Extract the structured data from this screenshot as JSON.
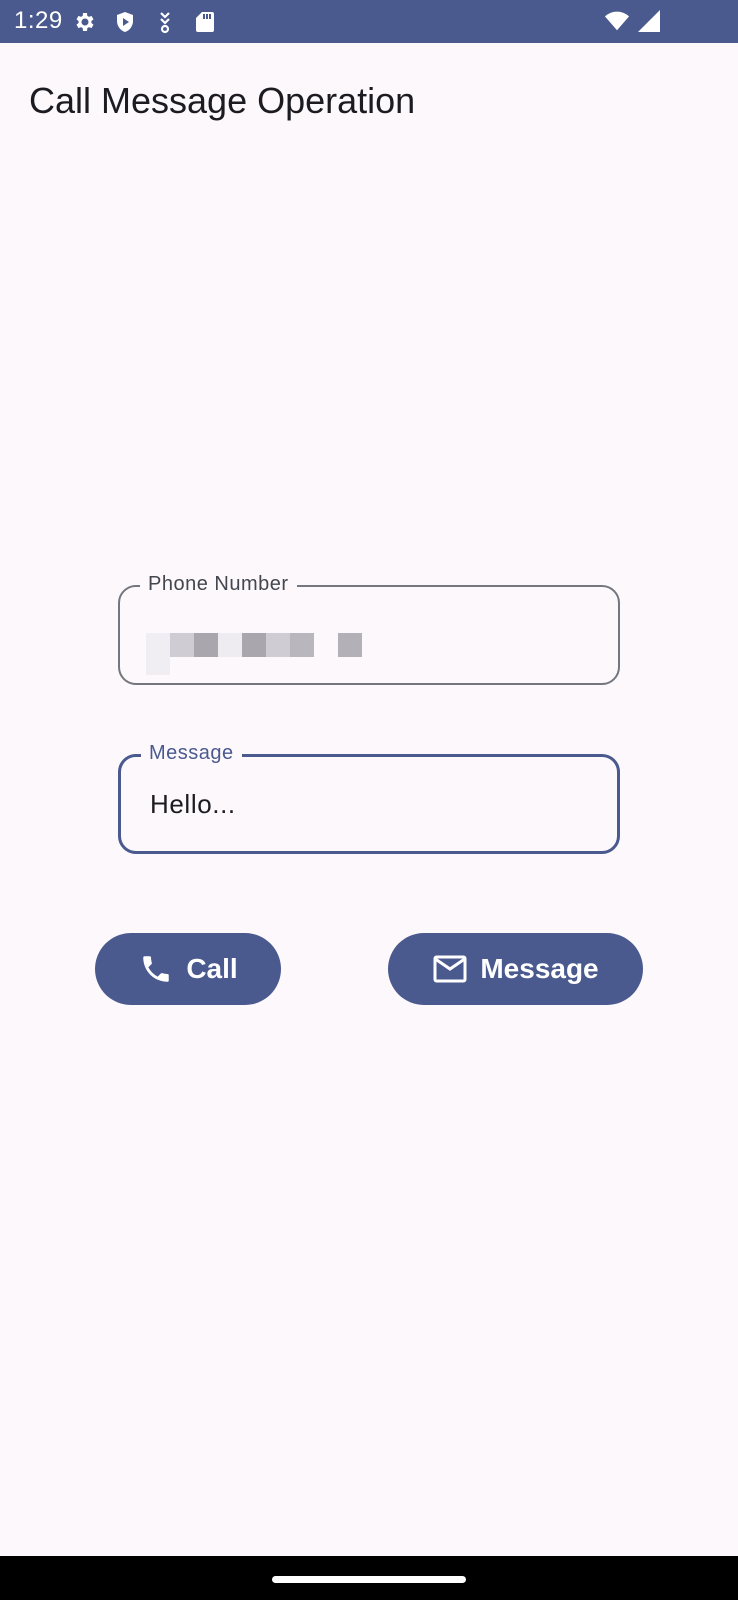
{
  "status_bar": {
    "time": "1:29",
    "icons": [
      "settings-icon",
      "shield-icon",
      "download-icon",
      "sd-card-icon",
      "wifi-icon",
      "signal-icon"
    ],
    "background_color": "#4a5a8f"
  },
  "app": {
    "title": "Call Message Operation"
  },
  "form": {
    "phone_field": {
      "label": "Phone Number",
      "value_redacted": true
    },
    "message_field": {
      "label": "Message",
      "value": "Hello..."
    }
  },
  "actions": {
    "call_label": "Call",
    "call_icon": "phone-icon",
    "message_label": "Message",
    "message_icon": "mail-icon",
    "button_color": "#4a5a8f"
  }
}
